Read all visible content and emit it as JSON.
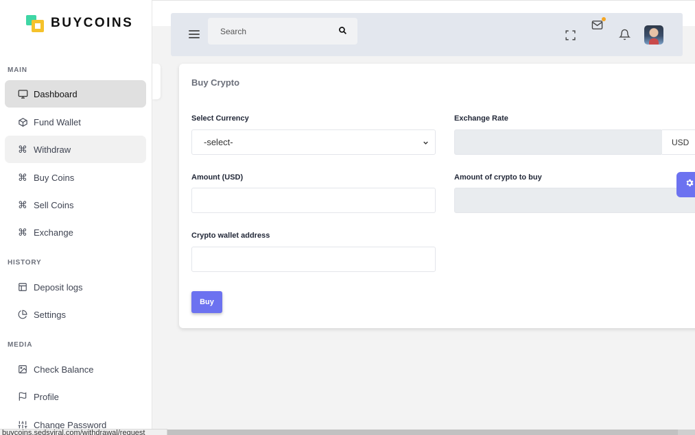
{
  "brand": {
    "name": "BUYCOINS"
  },
  "sidebar": {
    "sections": {
      "main": "MAIN",
      "history": "HISTORY",
      "media": "MEDIA"
    },
    "items": [
      {
        "label": "Dashboard",
        "icon": "monitor-icon"
      },
      {
        "label": "Fund Wallet",
        "icon": "box-icon"
      },
      {
        "label": "Withdraw",
        "icon": "command-icon"
      },
      {
        "label": "Buy Coins",
        "icon": "command-icon"
      },
      {
        "label": "Sell Coins",
        "icon": "command-icon"
      },
      {
        "label": "Exchange",
        "icon": "command-icon"
      },
      {
        "label": "Deposit logs",
        "icon": "layout-icon"
      },
      {
        "label": "Settings",
        "icon": "pie-chart-icon"
      },
      {
        "label": "Check Balance",
        "icon": "image-icon"
      },
      {
        "label": "Profile",
        "icon": "flag-icon"
      },
      {
        "label": "Change Password",
        "icon": "sliders-icon"
      }
    ]
  },
  "header": {
    "search_placeholder": "Search"
  },
  "card": {
    "title": "Buy Crypto",
    "select_currency_label": "Select Currency",
    "select_currency_value": "-select-",
    "exchange_rate_label": "Exchange Rate",
    "exchange_rate_value": "",
    "exchange_rate_unit": "USD",
    "amount_label": "Amount (USD)",
    "amount_value": "",
    "crypto_amount_label": "Amount of crypto to buy",
    "crypto_amount_value": "",
    "wallet_label": "Crypto wallet address",
    "wallet_value": "",
    "buy_button": "Buy"
  },
  "status_bar": {
    "url": "buycoins.sedsviral.com/withdrawal/request"
  },
  "colors": {
    "accent": "#6c72f0",
    "active_bg": "#e0e0e0",
    "header_bg": "#e3e7ee"
  }
}
